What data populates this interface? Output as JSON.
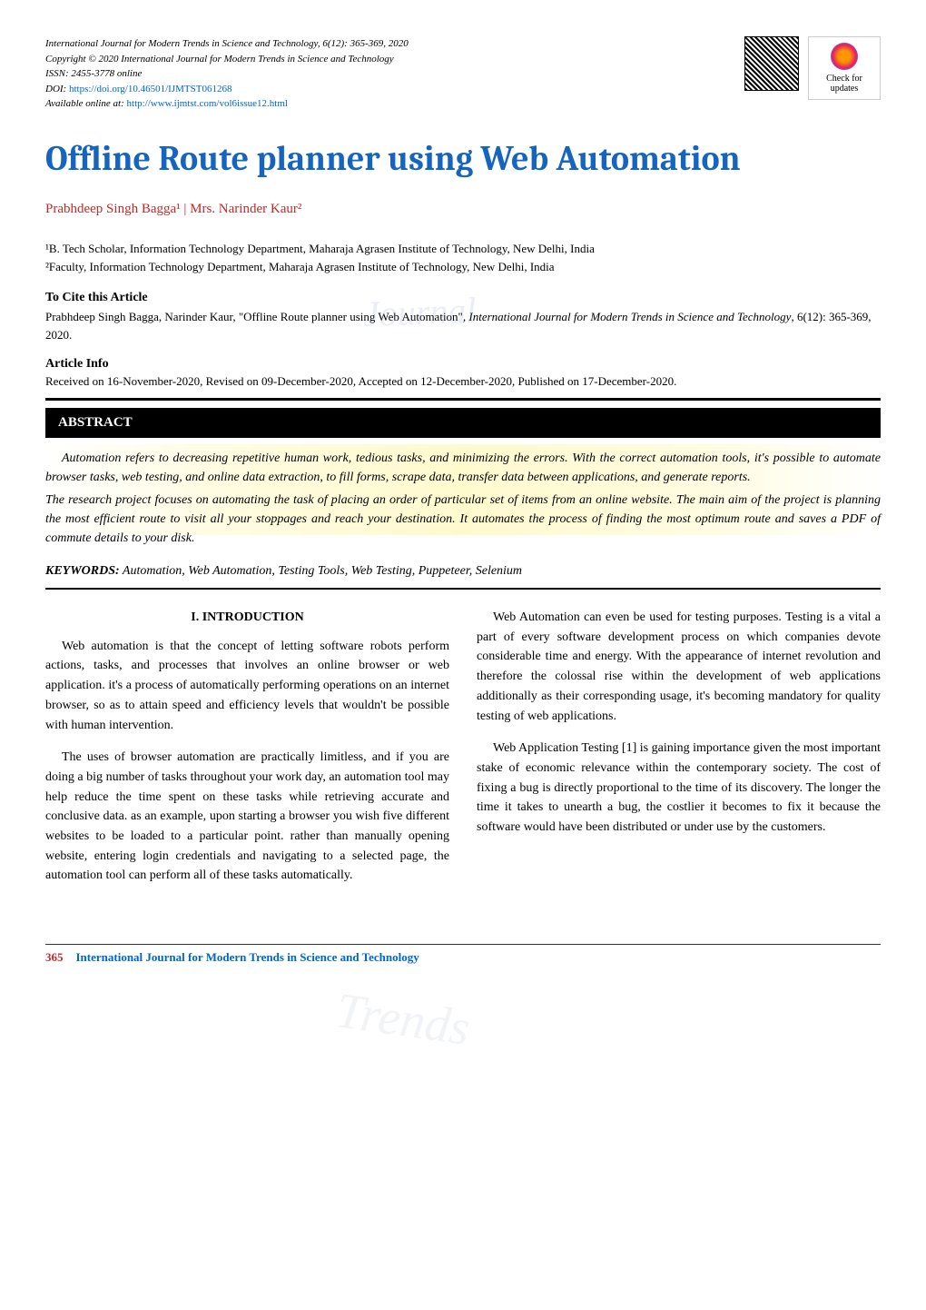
{
  "header": {
    "journal_line": "International Journal for Modern Trends in Science and Technology,",
    "issue": " 6(12): 365-369, 2020",
    "copyright": "Copyright © 2020 International Journal for Modern Trends in Science and Technology",
    "issn": "ISSN: 2455-3778 online",
    "doi_label": "DOI: ",
    "doi": "https://doi.org/10.46501/IJMTST061268",
    "avail_label": "Available online at: ",
    "avail_url": "http://www.ijmtst.com/vol6issue12.html",
    "badge_text1": "Check for",
    "badge_text2": "updates"
  },
  "title": "Offline Route planner using Web Automation",
  "authors": "Prabhdeep Singh Bagga¹ | Mrs. Narinder Kaur²",
  "affiliations": {
    "a1": "¹B. Tech Scholar, Information Technology Department, Maharaja Agrasen Institute of Technology, New Delhi, India",
    "a2": "²Faculty, Information Technology Department, Maharaja Agrasen Institute of Technology, New Delhi, India"
  },
  "cite": {
    "heading": "To Cite this Article",
    "text_pre": "Prabhdeep Singh Bagga, Narinder Kaur, \"Offline Route planner using Web Automation\"",
    "text_ital": ", International Journal for Modern Trends in Science and Technology",
    "text_post": ", 6(12): 365-369, 2020."
  },
  "article_info": {
    "heading": "Article Info",
    "text": "Received on 16-November-2020, Revised on 09-December-2020, Accepted on 12-December-2020, Published on 17-December-2020."
  },
  "abstract": {
    "heading": "ABSTRACT",
    "p1": "Automation refers to decreasing repetitive human work, tedious tasks, and minimizing the errors. With the correct automation tools, it's possible to automate browser tasks, web testing, and online data extraction, to fill forms, scrape data, transfer data between applications, and generate reports.",
    "p2": "The research project focuses on automating the task of placing an order of particular set of items from an online website. The main aim of the project is planning the most efficient route to visit all your stoppages and reach your destination. It automates the process of finding the most optimum route and saves a PDF of commute details to your disk."
  },
  "keywords": {
    "label": "KEYWORDS:",
    "text": " Automation, Web Automation, Testing Tools, Web Testing, Puppeteer, Selenium"
  },
  "intro_heading": "I. INTRODUCTION",
  "col_left": {
    "p1": "Web automation is that the concept of letting software robots perform actions, tasks, and processes that involves an online browser or web application. it's a process of automatically performing operations on an internet browser, so as to attain speed and efficiency levels that wouldn't be possible with human intervention.",
    "p2": "The uses of browser automation are practically limitless, and if you are doing a big number of tasks throughout your work day, an automation tool may help reduce the time spent on these tasks while retrieving accurate and conclusive data. as an example, upon starting a browser you wish five different websites to be loaded to a particular point. rather than manually opening website, entering login credentials and navigating to a selected page, the automation tool can perform all of these tasks automatically."
  },
  "col_right": {
    "p1": "Web Automation can even be used for testing purposes. Testing is a vital a part of every software development process on which companies devote considerable time and energy. With the appearance of internet revolution and therefore the colossal rise within the development of web applications additionally as their corresponding usage, it's becoming mandatory for quality testing of web applications.",
    "p2": "Web Application Testing [1] is gaining importance given the most important stake of economic relevance within the contemporary society. The cost of fixing a bug is directly proportional to the time of its discovery. The longer the time it takes to unearth a bug, the costlier it becomes to fix it because the software would have been distributed or under use by the customers."
  },
  "footer": {
    "page": "365",
    "journal": "International Journal for Modern Trends in Science and Technology"
  },
  "watermark": "Journal"
}
